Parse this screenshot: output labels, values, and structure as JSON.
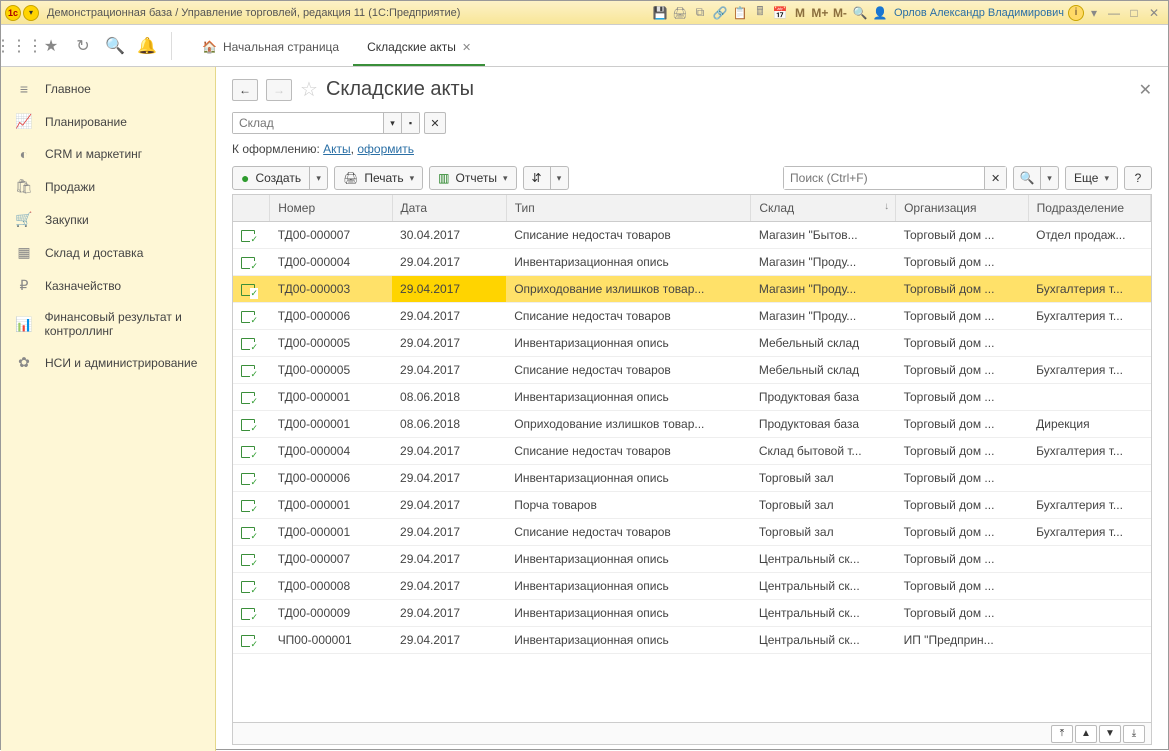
{
  "titlebar": {
    "title": "Демонстрационная база / Управление торговлей, редакция 11 (1С:Предприятие)",
    "user": "Орлов Александр Владимирович",
    "m_buttons": [
      "M",
      "M+",
      "M-"
    ]
  },
  "tabs": {
    "home": "Начальная страница",
    "active": "Складские акты"
  },
  "sidebar": {
    "items": [
      {
        "icon": "≡",
        "label": "Главное"
      },
      {
        "icon": "📈",
        "label": "Планирование"
      },
      {
        "icon": "◐",
        "label": "CRM и маркетинг"
      },
      {
        "icon": "🛍",
        "label": "Продажи"
      },
      {
        "icon": "🛒",
        "label": "Закупки"
      },
      {
        "icon": "▦",
        "label": "Склад и доставка"
      },
      {
        "icon": "₽",
        "label": "Казначейство"
      },
      {
        "icon": "📊",
        "label": "Финансовый результат и контроллинг"
      },
      {
        "icon": "✿",
        "label": "НСИ и администрирование"
      }
    ]
  },
  "page": {
    "title": "Складские акты",
    "filter_placeholder": "Склад",
    "link_prefix": "К оформлению:",
    "link_acts": "Акты",
    "link_sep": ",",
    "link_create": "оформить"
  },
  "cmdbar": {
    "create": "Создать",
    "print": "Печать",
    "reports": "Отчеты",
    "search_placeholder": "Поиск (Ctrl+F)",
    "more": "Еще",
    "help": "?"
  },
  "table": {
    "headers": {
      "number": "Номер",
      "date": "Дата",
      "type": "Тип",
      "warehouse": "Склад",
      "org": "Организация",
      "dep": "Подразделение"
    },
    "rows": [
      {
        "n": "ТД00-000007",
        "d": "30.04.2017",
        "t": "Списание недостач товаров",
        "w": "Магазин \"Бытов...",
        "o": "Торговый дом ...",
        "p": "Отдел продаж..."
      },
      {
        "n": "ТД00-000004",
        "d": "29.04.2017",
        "t": "Инвентаризационная опись",
        "w": "Магазин \"Проду...",
        "o": "Торговый дом ...",
        "p": ""
      },
      {
        "n": "ТД00-000003",
        "d": "29.04.2017",
        "t": "Оприходование излишков товар...",
        "w": "Магазин \"Проду...",
        "o": "Торговый дом ...",
        "p": "Бухгалтерия т...",
        "sel": true
      },
      {
        "n": "ТД00-000006",
        "d": "29.04.2017",
        "t": "Списание недостач товаров",
        "w": "Магазин \"Проду...",
        "o": "Торговый дом ...",
        "p": "Бухгалтерия т..."
      },
      {
        "n": "ТД00-000005",
        "d": "29.04.2017",
        "t": "Инвентаризационная опись",
        "w": "Мебельный склад",
        "o": "Торговый дом ...",
        "p": ""
      },
      {
        "n": "ТД00-000005",
        "d": "29.04.2017",
        "t": "Списание недостач товаров",
        "w": "Мебельный склад",
        "o": "Торговый дом ...",
        "p": "Бухгалтерия т..."
      },
      {
        "n": "ТД00-000001",
        "d": "08.06.2018",
        "t": "Инвентаризационная опись",
        "w": "Продуктовая база",
        "o": "Торговый дом ...",
        "p": ""
      },
      {
        "n": "ТД00-000001",
        "d": "08.06.2018",
        "t": "Оприходование излишков товар...",
        "w": "Продуктовая база",
        "o": "Торговый дом ...",
        "p": "Дирекция"
      },
      {
        "n": "ТД00-000004",
        "d": "29.04.2017",
        "t": "Списание недостач товаров",
        "w": "Склад бытовой т...",
        "o": "Торговый дом ...",
        "p": "Бухгалтерия т..."
      },
      {
        "n": "ТД00-000006",
        "d": "29.04.2017",
        "t": "Инвентаризационная опись",
        "w": "Торговый зал",
        "o": "Торговый дом ...",
        "p": ""
      },
      {
        "n": "ТД00-000001",
        "d": "29.04.2017",
        "t": "Порча товаров",
        "w": "Торговый зал",
        "o": "Торговый дом ...",
        "p": "Бухгалтерия т..."
      },
      {
        "n": "ТД00-000001",
        "d": "29.04.2017",
        "t": "Списание недостач товаров",
        "w": "Торговый зал",
        "o": "Торговый дом ...",
        "p": "Бухгалтерия т..."
      },
      {
        "n": "ТД00-000007",
        "d": "29.04.2017",
        "t": "Инвентаризационная опись",
        "w": "Центральный ск...",
        "o": "Торговый дом ...",
        "p": ""
      },
      {
        "n": "ТД00-000008",
        "d": "29.04.2017",
        "t": "Инвентаризационная опись",
        "w": "Центральный ск...",
        "o": "Торговый дом ...",
        "p": ""
      },
      {
        "n": "ТД00-000009",
        "d": "29.04.2017",
        "t": "Инвентаризационная опись",
        "w": "Центральный ск...",
        "o": "Торговый дом ...",
        "p": ""
      },
      {
        "n": "ЧП00-000001",
        "d": "29.04.2017",
        "t": "Инвентаризационная опись",
        "w": "Центральный ск...",
        "o": "ИП \"Предприн...",
        "p": ""
      }
    ]
  }
}
